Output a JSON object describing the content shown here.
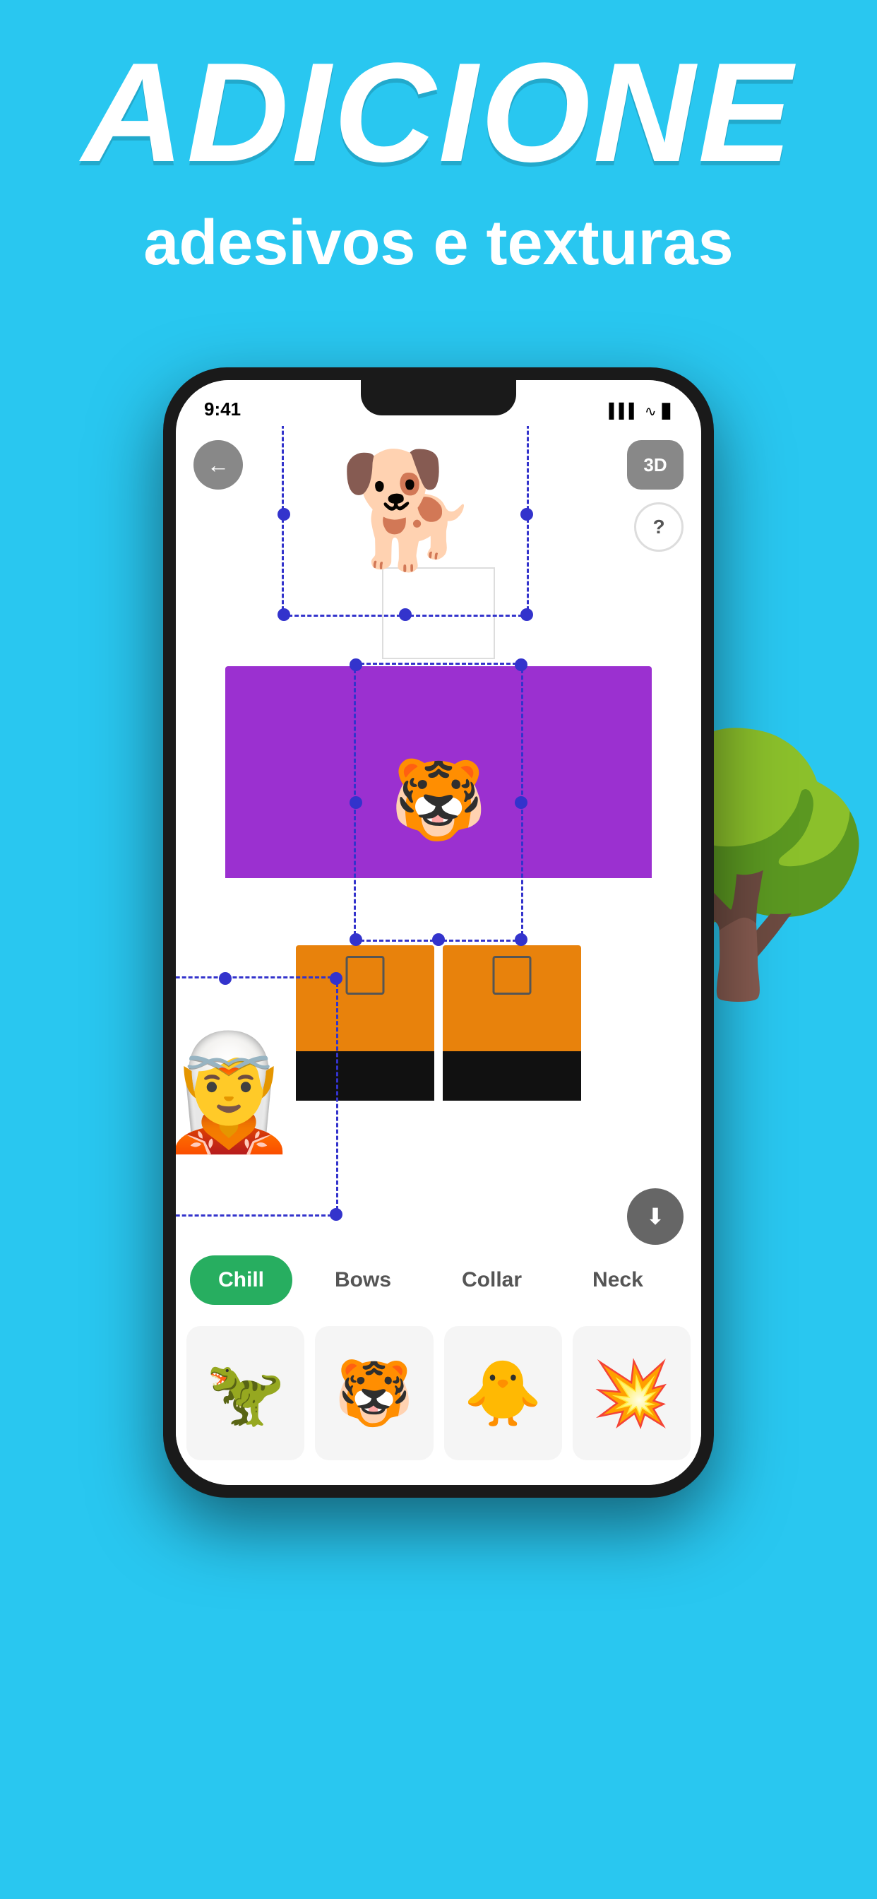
{
  "header": {
    "main_title": "ADICIONE",
    "subtitle": "adesivos e texturas"
  },
  "status_bar": {
    "time": "9:41",
    "icons": "▌▌▌ ))) ▊"
  },
  "buttons": {
    "back": "←",
    "three_d": "3D",
    "help": "?",
    "download": "⬇"
  },
  "categories": [
    {
      "label": "Chill",
      "active": true
    },
    {
      "label": "Bows",
      "active": false
    },
    {
      "label": "Collar",
      "active": false
    },
    {
      "label": "Neck",
      "active": false
    }
  ],
  "stickers": [
    {
      "emoji": "🦖",
      "name": "dinosaur"
    },
    {
      "emoji": "🐯",
      "name": "tiger"
    },
    {
      "emoji": "🐥",
      "name": "duck"
    },
    {
      "emoji": "💥",
      "name": "explosion"
    }
  ],
  "colors": {
    "background": "#29C7F0",
    "shirt": "#9B30D0",
    "pants": "#E8820C",
    "active_tab": "#27AE60",
    "download_btn": "#666666"
  }
}
